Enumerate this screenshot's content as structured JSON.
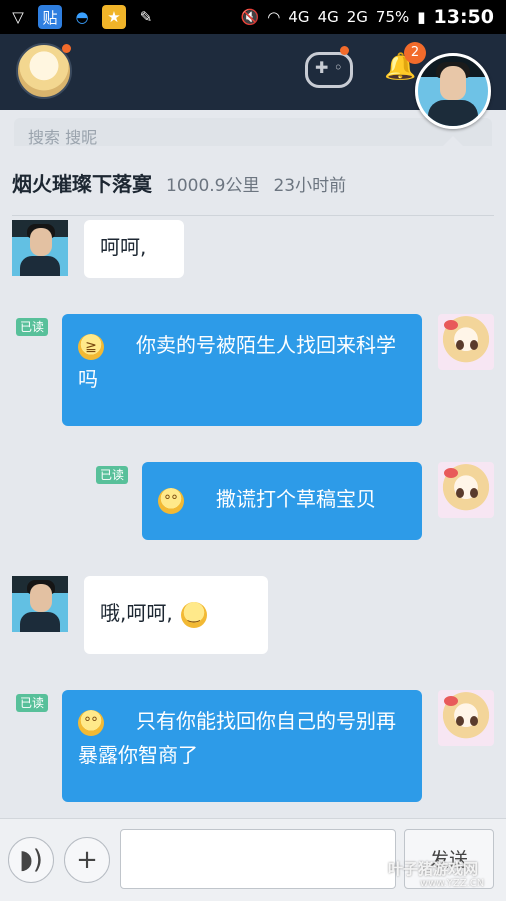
{
  "status_bar": {
    "time": "13:50",
    "battery": "75%",
    "network_1": "4G",
    "network_2": "4G",
    "network_3": "2G",
    "app_icons": [
      "vpn-icon",
      "tieba-icon",
      "qq-icon",
      "game-center-icon",
      "pen-icon"
    ],
    "tieba_label": "贴"
  },
  "top_bar": {
    "notification_count": "2",
    "search_hint": "搜索 搜昵"
  },
  "chat": {
    "name": "烟火璀璨下落寞",
    "distance": "1000.9公里",
    "time_ago": "23小时前"
  },
  "messages": [
    {
      "side": "left",
      "text": "呵呵,"
    },
    {
      "side": "right",
      "read": "已读",
      "emoji": "laugh-emoji",
      "text": "你卖的号被陌生人找回来科学吗"
    },
    {
      "side": "right",
      "read": "已读",
      "emoji": "wide-eyed-emoji",
      "text": "撒谎打个草稿宝贝"
    },
    {
      "side": "left",
      "text": "哦,呵呵,",
      "emoji": "smile-emoji"
    },
    {
      "side": "right",
      "read": "已读",
      "emoji": "wide-eyed-emoji",
      "text": "只有你能找回你自己的号别再暴露你智商了"
    }
  ],
  "input_bar": {
    "send_label": "发送",
    "input_value": ""
  },
  "watermark": {
    "text": "叶子猪游戏网",
    "url": "www.YZZ.CN"
  },
  "colors": {
    "bubble_right": "#2d9be8",
    "read_tag": "#58c09a",
    "top_bar": "#1e2b3d",
    "badge": "#f26b2b"
  }
}
